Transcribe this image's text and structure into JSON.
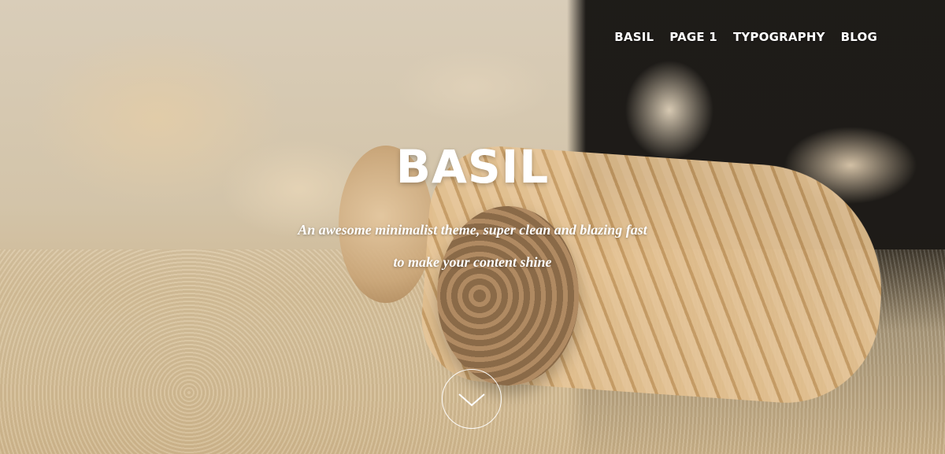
{
  "nav": {
    "items": [
      {
        "label": "BASIL"
      },
      {
        "label": "PAGE 1"
      },
      {
        "label": "TYPOGRAPHY"
      },
      {
        "label": "BLOG"
      }
    ]
  },
  "hero": {
    "title": "BASIL",
    "tagline_line1": "An awesome minimalist theme, super clean and blazing fast",
    "tagline_line2": "to make your content shine",
    "scroll_icon": "chevron-down-icon"
  }
}
